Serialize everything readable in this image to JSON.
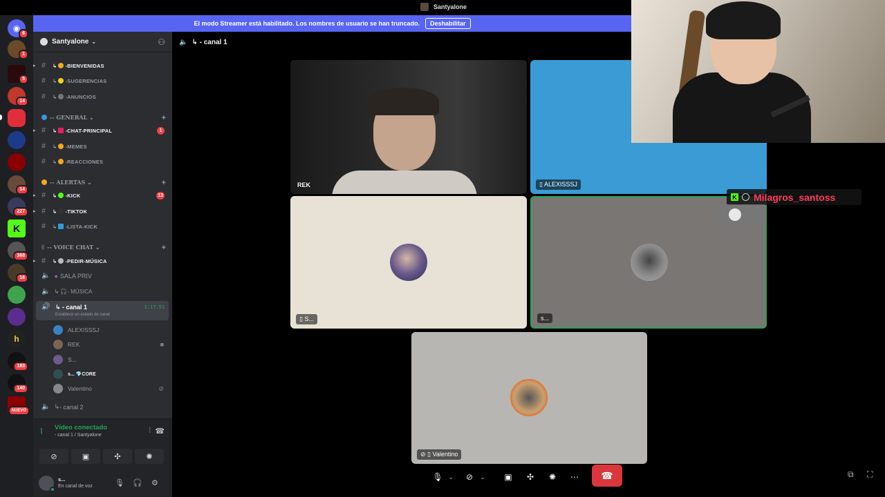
{
  "window": {
    "title": "Santyalone"
  },
  "banner": {
    "text": "El modo Streamer está habilitado. Los nombres de usuario se han truncado.",
    "button": "Deshabilitar"
  },
  "server_rail": {
    "badges": [
      "6",
      "1",
      "5",
      "14",
      "14",
      "227",
      "368",
      "16",
      "183",
      "140"
    ],
    "new_label": "NUEVO"
  },
  "server": {
    "name": "Santyalone"
  },
  "channels": {
    "top": [
      {
        "name": "-BIENVENIDAS",
        "bright": true
      },
      {
        "name": "-SUGERENCIAS",
        "bright": false
      },
      {
        "name": "-ANUNCIOS",
        "bright": false
      }
    ],
    "general": {
      "title": "-- GENERAL",
      "items": [
        {
          "name": "-CHAT-PRINCIPAL",
          "bright": true,
          "badge": "1"
        },
        {
          "name": "-MEMES",
          "bright": false
        },
        {
          "name": "-REACCIONES",
          "bright": false
        }
      ]
    },
    "alertas": {
      "title": "-- ALERTAS",
      "items": [
        {
          "name": "-KICK",
          "bright": true,
          "badge": "13"
        },
        {
          "name": "-TIKTOK",
          "bright": true
        },
        {
          "name": "-LISTA-KICK",
          "bright": false
        }
      ]
    },
    "voice": {
      "title": "-- VOICE CHAT",
      "items": [
        {
          "name": "-PEDIR-MÚSICA",
          "bright": true
        },
        {
          "name": "SALA PRIV"
        },
        {
          "name": "- MÚSICA"
        }
      ]
    },
    "active": {
      "name": "- canal 1",
      "time": "1:17:51",
      "status": "Establece un estado de canal"
    },
    "members": [
      "ALEXISSSJ",
      "REK",
      "S...",
      "s...",
      "Valentino"
    ],
    "member_tag": "CORE",
    "next": "- canal 2"
  },
  "voice_panel": {
    "status": "Vídeo conectado",
    "sub": "- canal 1 / Santyalone",
    "user": "s...",
    "user_status": "En canal de voz"
  },
  "main": {
    "channel_header": "- canal 1",
    "tiles": [
      {
        "label": "REK"
      },
      {
        "label": "ALEXISSSJ"
      },
      {
        "label": "S..."
      },
      {
        "label": "s..."
      },
      {
        "label": "Valentino"
      }
    ]
  },
  "overlay": {
    "chat_user": "Milagros_santoss",
    "kick_letter": "K"
  },
  "colors": {
    "accent": "#5865f2",
    "green": "#23a55a",
    "red": "#da373c",
    "kick": "#53fc18"
  }
}
